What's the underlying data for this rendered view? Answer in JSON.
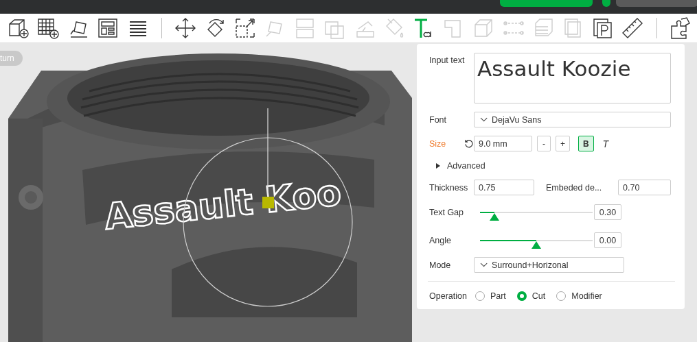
{
  "toolbar": [
    {
      "kind": "add-cube",
      "disabled": false
    },
    {
      "kind": "add-grid",
      "disabled": false
    },
    {
      "kind": "auto-orient",
      "disabled": false
    },
    {
      "kind": "arrange",
      "disabled": false
    },
    {
      "kind": "lines",
      "disabled": false
    },
    {
      "kind": "separator"
    },
    {
      "kind": "move",
      "disabled": false
    },
    {
      "kind": "rotate",
      "disabled": false
    },
    {
      "kind": "scale",
      "disabled": false
    },
    {
      "kind": "lay-flat",
      "disabled": true
    },
    {
      "kind": "split",
      "disabled": true
    },
    {
      "kind": "overlap",
      "disabled": true
    },
    {
      "kind": "support",
      "disabled": true
    },
    {
      "kind": "paint",
      "disabled": true
    },
    {
      "kind": "text",
      "disabled": false
    },
    {
      "kind": "boolean",
      "disabled": true
    },
    {
      "kind": "cube",
      "disabled": true
    },
    {
      "kind": "connector",
      "disabled": true
    },
    {
      "kind": "layers",
      "disabled": true
    },
    {
      "kind": "pages",
      "disabled": true
    },
    {
      "kind": "plate-p",
      "disabled": false
    },
    {
      "kind": "ruler",
      "disabled": false
    },
    {
      "kind": "separator"
    },
    {
      "kind": "puzzle",
      "disabled": false
    }
  ],
  "viewport": {
    "return_button": "turn",
    "model_text": "Assault Koo"
  },
  "panel": {
    "input_text": {
      "label": "Input text",
      "value": "Assault Koozie"
    },
    "font": {
      "label": "Font",
      "value": "DejaVu Sans"
    },
    "size": {
      "label": "Size",
      "value": "9.0 mm",
      "minus": "-",
      "plus": "+",
      "bold": {
        "label": "B",
        "selected": true
      },
      "italic": {
        "label": "T",
        "selected": false
      }
    },
    "advanced": {
      "label": "Advanced",
      "expanded": false
    },
    "thickness": {
      "label": "Thickness",
      "value": "0.75"
    },
    "embedded": {
      "label": "Embeded de...",
      "value": "0.70"
    },
    "text_gap": {
      "label": "Text Gap",
      "level": 0.13,
      "value": "0.30"
    },
    "angle": {
      "label": "Angle",
      "level": 0.5,
      "value": "0.00"
    },
    "mode": {
      "label": "Mode",
      "value": "Surround+Horizonal"
    },
    "operation": {
      "label": "Operation",
      "options": [
        {
          "label": "Part",
          "selected": false
        },
        {
          "label": "Cut",
          "selected": true
        },
        {
          "label": "Modifier",
          "selected": false
        }
      ]
    }
  }
}
